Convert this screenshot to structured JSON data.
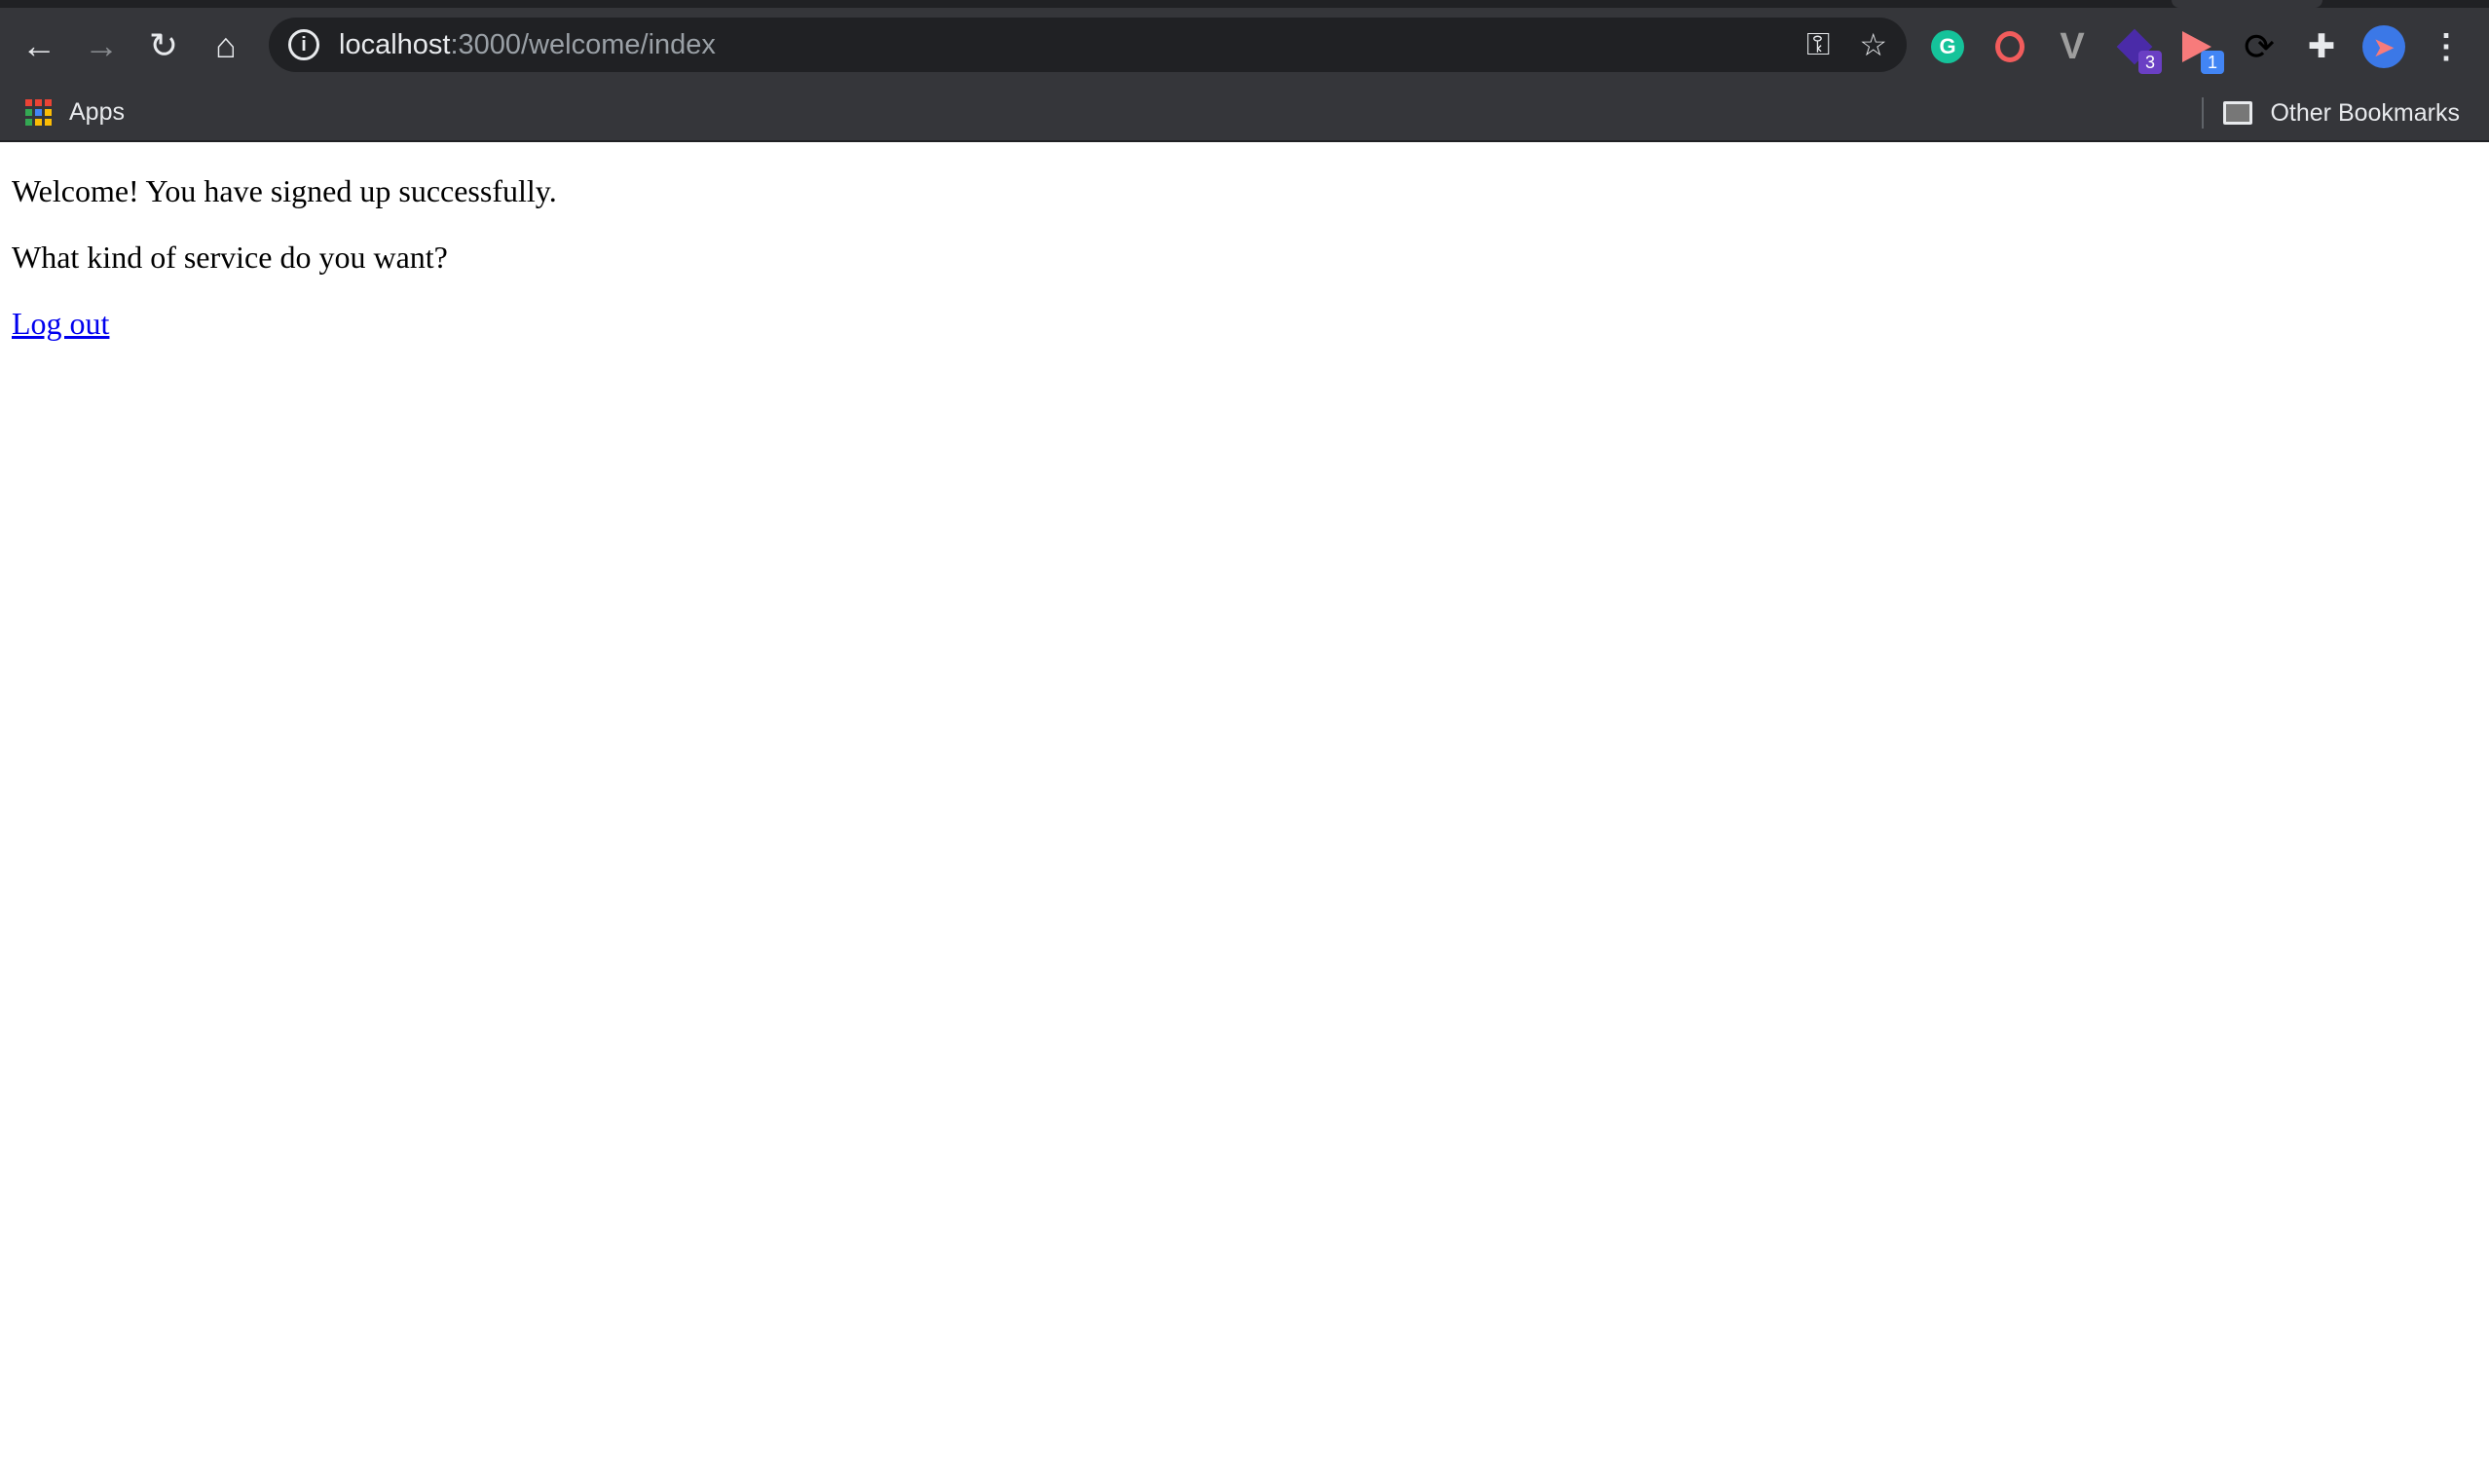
{
  "browser": {
    "url_host": "localhost",
    "url_rest": ":3000/welcome/index",
    "bookmarks": {
      "apps_label": "Apps",
      "other_label": "Other Bookmarks"
    },
    "extensions": [
      {
        "name": "grammarly-icon",
        "color": "#15c39a"
      },
      {
        "name": "spiral-icon",
        "color": "#f25c5c"
      },
      {
        "name": "vue-devtools-icon",
        "color": "#9e9e9e"
      },
      {
        "name": "layers-icon",
        "color": "#4a2ba8",
        "badge": "3"
      },
      {
        "name": "video-icon",
        "color": "#f77b7b",
        "badge": "1"
      },
      {
        "name": "sync-icon",
        "color": "#000000"
      },
      {
        "name": "puzzle-icon",
        "color": "#e8eaed"
      }
    ]
  },
  "page": {
    "welcome": "Welcome! You have signed up successfully.",
    "question": "What kind of service do you want?",
    "logout": "Log out"
  }
}
